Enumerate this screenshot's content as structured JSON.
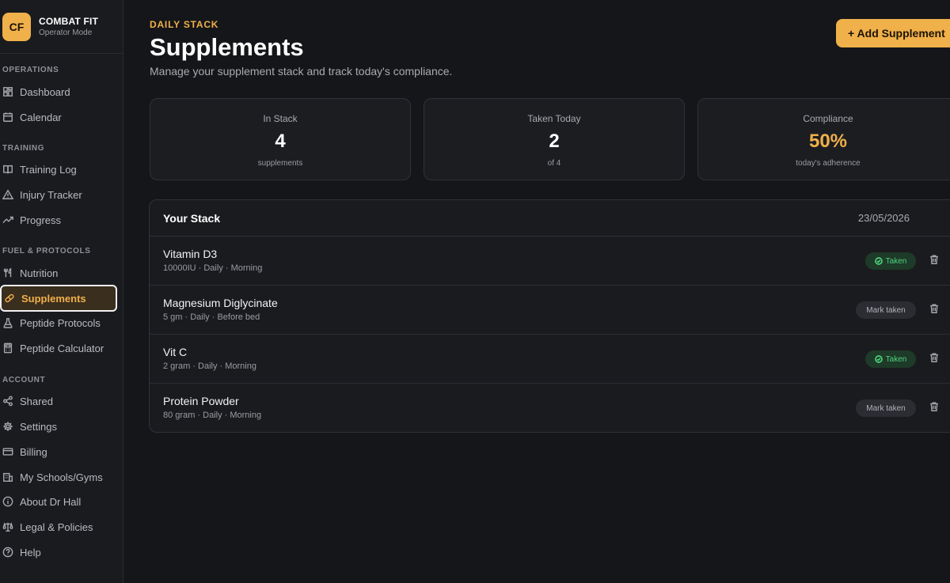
{
  "app": {
    "logo_text": "CF",
    "name": "COMBAT FIT",
    "mode": "Operator Mode"
  },
  "sidebar": {
    "sections": [
      {
        "label": "OPERATIONS",
        "items": [
          {
            "label": "Dashboard",
            "icon": "dashboard-icon"
          },
          {
            "label": "Calendar",
            "icon": "calendar-icon"
          }
        ]
      },
      {
        "label": "TRAINING",
        "items": [
          {
            "label": "Training Log",
            "icon": "book-icon"
          },
          {
            "label": "Injury Tracker",
            "icon": "warning-icon"
          },
          {
            "label": "Progress",
            "icon": "trend-icon"
          }
        ]
      },
      {
        "label": "FUEL & PROTOCOLS",
        "items": [
          {
            "label": "Nutrition",
            "icon": "utensils-icon"
          },
          {
            "label": "Supplements",
            "icon": "pill-icon",
            "active": true
          },
          {
            "label": "Peptide Protocols",
            "icon": "flask-icon"
          },
          {
            "label": "Peptide Calculator",
            "icon": "calculator-icon"
          }
        ]
      },
      {
        "label": "ACCOUNT",
        "items": [
          {
            "label": "Shared",
            "icon": "share-icon"
          },
          {
            "label": "Settings",
            "icon": "gear-icon"
          },
          {
            "label": "Billing",
            "icon": "card-icon"
          },
          {
            "label": "My Schools/Gyms",
            "icon": "building-icon"
          },
          {
            "label": "About Dr Hall",
            "icon": "info-icon"
          },
          {
            "label": "Legal & Policies",
            "icon": "scale-icon"
          },
          {
            "label": "Help",
            "icon": "help-icon"
          }
        ]
      }
    ]
  },
  "header": {
    "eyebrow": "DAILY STACK",
    "title": "Supplements",
    "subtitle": "Manage your supplement stack and track today's compliance.",
    "add_button": "+ Add Supplement"
  },
  "stats": [
    {
      "label": "In Stack",
      "value": "4",
      "note": "supplements"
    },
    {
      "label": "Taken Today",
      "value": "2",
      "note": "of 4"
    },
    {
      "label": "Compliance",
      "value": "50%",
      "note": "today's adherence"
    }
  ],
  "stack": {
    "title": "Your Stack",
    "date": "23/05/2026",
    "taken_label": "Taken",
    "mark_label": "Mark taken",
    "items": [
      {
        "name": "Vitamin D3",
        "meta": "10000IU · Daily · Morning",
        "taken": true
      },
      {
        "name": "Magnesium Diglycinate",
        "meta": "5 gm · Daily · Before bed",
        "taken": false
      },
      {
        "name": "Vit C",
        "meta": "2 gram · Daily · Morning",
        "taken": true
      },
      {
        "name": "Protein Powder",
        "meta": "80 gram · Daily · Morning",
        "taken": false
      }
    ]
  },
  "colors": {
    "accent": "#f0b04a",
    "taken_green": "#4fd27e",
    "background": "#151619"
  }
}
